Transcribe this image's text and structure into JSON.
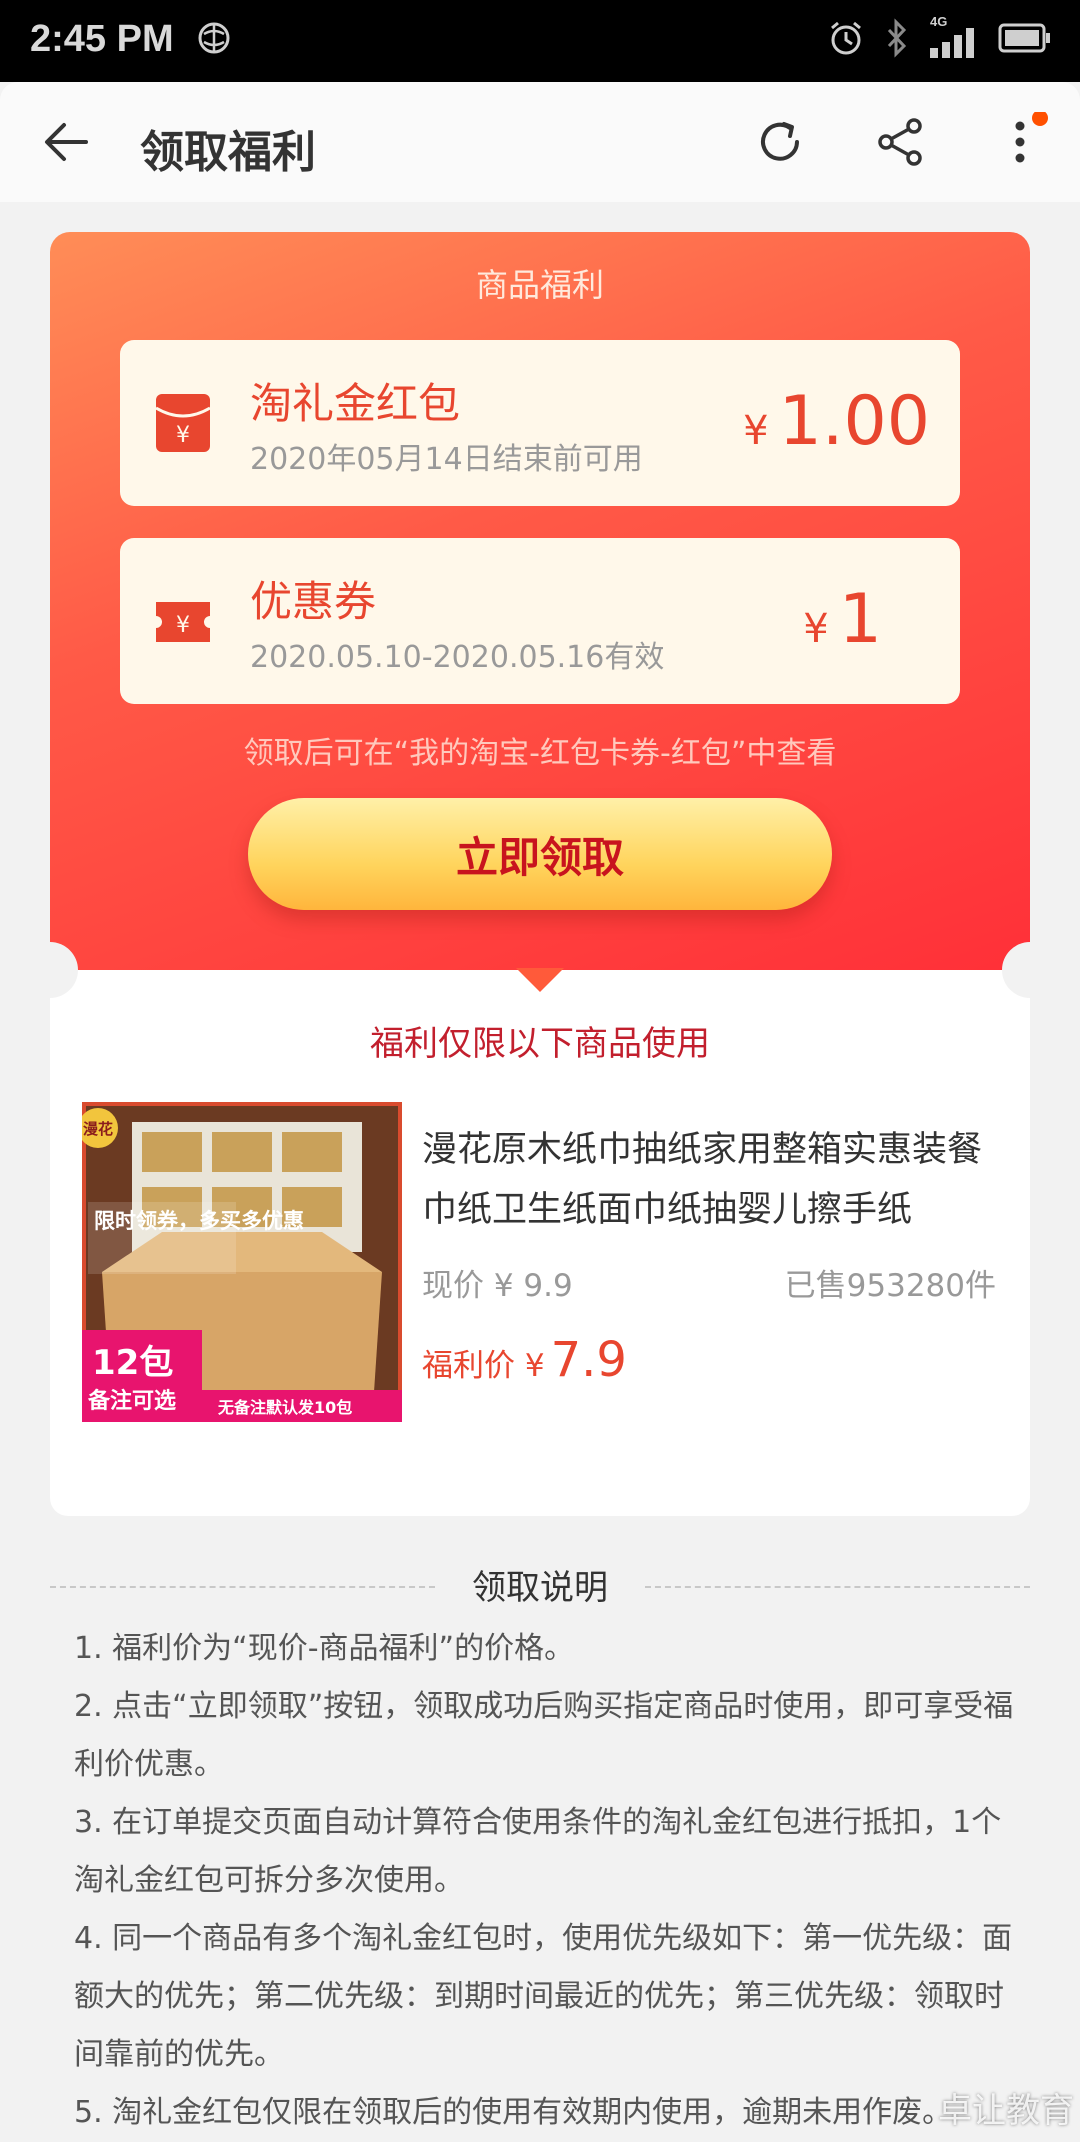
{
  "status_bar": {
    "time": "2:45 PM",
    "network": "4G"
  },
  "app_bar": {
    "title": "领取福利"
  },
  "benefit": {
    "title": "商品福利",
    "coupons": [
      {
        "name": "淘礼金红包",
        "date": "2020年05月14日结束前可用",
        "currency": "¥",
        "amount": "1.00"
      },
      {
        "name": "优惠券",
        "date": "2020.05.10-2020.05.16有效",
        "currency": "¥",
        "amount": "1"
      }
    ],
    "hint": "领取后可在“我的淘宝-红包卡券-红包”中查看",
    "claim_button": "立即领取"
  },
  "product_section": {
    "title": "福利仅限以下商品使用",
    "product": {
      "name": "漫花原木纸巾抽纸家用整箱实惠装餐巾纸卫生纸面巾纸抽婴儿擦手纸",
      "price_now": "现价 ¥ 9.9",
      "sold": "已售953280件",
      "welfare_label": "福利价 ¥",
      "welfare_price": "7.9",
      "image_texts": {
        "brand": "漫花",
        "promo": "限时领券，多买多优惠",
        "count": "12包",
        "note": "备注可选",
        "default": "无备注默认发10包"
      }
    }
  },
  "notes": {
    "title": "领取说明",
    "items": [
      "1. 福利价为“现价-商品福利”的价格。",
      "2. 点击“立即领取”按钮，领取成功后购买指定商品时使用，即可享受福利价优惠。",
      "3. 在订单提交页面自动计算符合使用条件的淘礼金红包进行抵扣，1个淘礼金红包可拆分多次使用。",
      "4. 同一个商品有多个淘礼金红包时，使用优先级如下：第一优先级：面额大的优先；第二优先级：到期时间最近的优先；第三优先级：领取时间靠前的优先。",
      "5. 淘礼金红包仅限在领取后的使用有效期内使用，逾期未用作废。"
    ]
  },
  "watermark": "卓让教育",
  "colors": {
    "accent": "#e8462f",
    "gradient_start": "#ff8d57",
    "gradient_end": "#ff3038",
    "button": "#ffd45c"
  }
}
